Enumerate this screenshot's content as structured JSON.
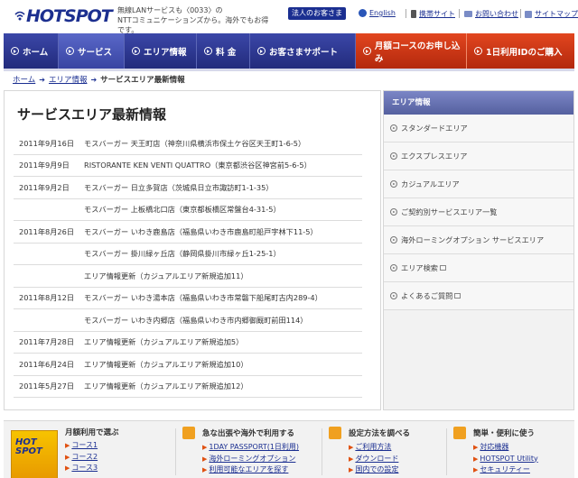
{
  "header": {
    "logo_text": "HOTSPOT",
    "tagline_line1": "無線LANサービスも〈0033〉の",
    "tagline_line2": "NTTコミュニケーションズから。海外でもお得です。",
    "corp_button": "法人のお客さま",
    "links": [
      {
        "label": "English",
        "icon": "globe-icon"
      },
      {
        "label": "携帯サイト",
        "icon": "mobile-icon"
      },
      {
        "label": "お問い合わせ",
        "icon": "mail-icon"
      },
      {
        "label": "サイトマップ",
        "icon": "sitemap-icon"
      }
    ]
  },
  "nav": {
    "items": [
      {
        "label": "ホーム",
        "active": false
      },
      {
        "label": "サービス",
        "active": true
      },
      {
        "label": "エリア情報",
        "active": false
      },
      {
        "label": "料 金",
        "active": false
      },
      {
        "label": "お客さまサポート",
        "active": false
      },
      {
        "label": "月額コースのお申し込み",
        "accent": true
      },
      {
        "label": "1日利用IDのご購入",
        "accent": true
      }
    ]
  },
  "breadcrumb": {
    "home": "ホーム",
    "area": "エリア情報",
    "current": "サービスエリア最新情報"
  },
  "main": {
    "title": "サービスエリア最新情報",
    "rows": [
      {
        "date": "2011年9月16日",
        "text": "モスバーガー 天王町店（神奈川県横浜市保土ケ谷区天王町1-6-5）"
      },
      {
        "date": "2011年9月9日",
        "text": "RISTORANTE KEN VENTI QUATTRO（東京都渋谷区神宮前5-6-5）"
      },
      {
        "date": "2011年9月2日",
        "text": "モスバーガー 日立多賀店（茨城県日立市諏訪町1-1-35）"
      },
      {
        "date": "",
        "text": "モスバーガー 上板橋北口店（東京都板橋区常盤台4-31-5）"
      },
      {
        "date": "2011年8月26日",
        "text": "モスバーガー いわき鹿島店（福島県いわき市鹿島町船戸字林下11-5）"
      },
      {
        "date": "",
        "text": "モスバーガー 掛川緑ヶ丘店（静岡県掛川市緑ヶ丘1-25-1）"
      },
      {
        "date": "",
        "text": "エリア情報更新（カジュアルエリア新規追加11）"
      },
      {
        "date": "2011年8月12日",
        "text": "モスバーガー いわき湯本店（福島県いわき市常磐下船尾町古内289-4）"
      },
      {
        "date": "",
        "text": "モスバーガー いわき内郷店（福島県いわき市内郷御厩町前田114）"
      },
      {
        "date": "2011年7月28日",
        "text": "エリア情報更新（カジュアルエリア新規追加5）"
      },
      {
        "date": "2011年6月24日",
        "text": "エリア情報更新（カジュアルエリア新規追加10）"
      },
      {
        "date": "2011年5月27日",
        "text": "エリア情報更新（カジュアルエリア新規追加12）"
      }
    ]
  },
  "sidebar": {
    "title": "エリア情報",
    "items": [
      {
        "label": "スタンダードエリア",
        "window": false
      },
      {
        "label": "エクスプレスエリア",
        "window": false
      },
      {
        "label": "カジュアルエリア",
        "window": false
      },
      {
        "label": "ご契約別サービスエリア一覧",
        "window": false
      },
      {
        "label": "海外ローミングオプション サービスエリア",
        "window": false
      },
      {
        "label": "エリア検索",
        "window": true
      },
      {
        "label": "よくあるご質問",
        "window": true
      }
    ]
  },
  "footer": {
    "col1": {
      "title": "月額利用で選ぶ",
      "links": [
        "コース1",
        "コース2",
        "コース3"
      ],
      "thumb": "HOT SPOT"
    },
    "col2": {
      "title": "急な出張や海外で利用する",
      "links": [
        "1DAY PASSPORT(1日利用)",
        "海外ローミングオプション",
        "利用可能なエリアを探す"
      ]
    },
    "col3": {
      "title": "設定方法を調べる",
      "links": [
        "ご利用方法",
        "ダウンロード",
        "国内での設定"
      ]
    },
    "col4": {
      "title": "簡単・便利に使う",
      "links": [
        "対応機器",
        "HOTSPOT Utility",
        "セキュリティー"
      ]
    }
  },
  "colors": {
    "brand_blue": "#1b2f91",
    "nav_blue": "#2c3690",
    "accent_red": "#d23a14",
    "sidebar_head": "#6a75b6"
  }
}
